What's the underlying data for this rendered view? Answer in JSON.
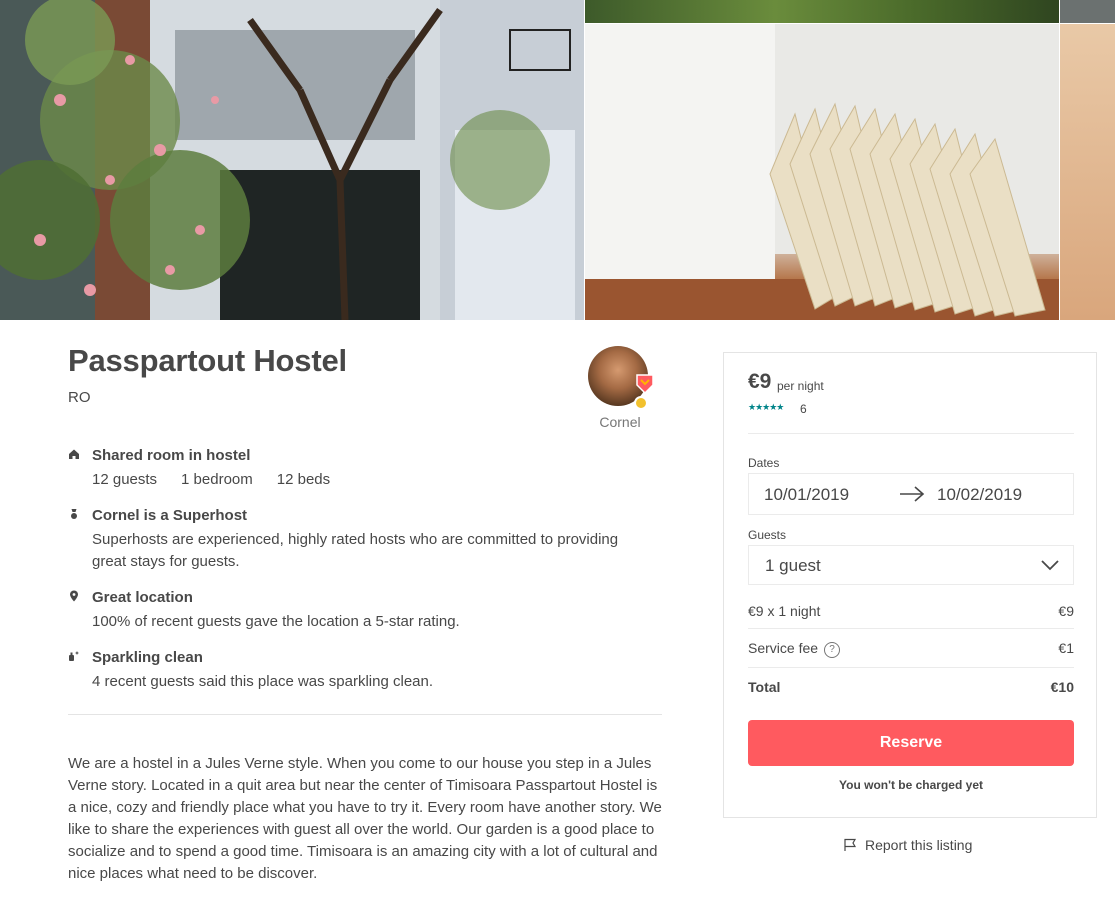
{
  "listing": {
    "title": "Passpartout Hostel",
    "country": "RO",
    "host_name": "Cornel"
  },
  "features": [
    {
      "icon": "home-icon",
      "title": "Shared room in hostel",
      "specs": [
        "12 guests",
        "1 bedroom",
        "12 beds"
      ]
    },
    {
      "icon": "superhost-medal-icon",
      "title": "Cornel is a Superhost",
      "desc": "Superhosts are experienced, highly rated hosts who are committed to providing great stays for guests."
    },
    {
      "icon": "location-pin-icon",
      "title": "Great location",
      "desc": "100% of recent guests gave the location a 5-star rating."
    },
    {
      "icon": "sparkle-clean-icon",
      "title": "Sparkling clean",
      "desc": "4 recent guests said this place was sparkling clean."
    }
  ],
  "description": "We are a hostel in a Jules Verne style. When you come to our house you step in a Jules Verne story. Located in a quit area but near the center of Timisoara Passpartout Hostel is a nice, cozy and friendly place what you have to try it. Every room have another story. We like to share the experiences with guest all over the world. Our garden is a good place to socialize and to spend a good time. Timisoara is an amazing city with a lot of cultural and nice places what need to be discover.",
  "booking": {
    "price": "€9",
    "per_night": "per night",
    "stars": "★★★★★",
    "review_count": "6",
    "dates_label": "Dates",
    "check_in": "10/01/2019",
    "check_out": "10/02/2019",
    "guests_label": "Guests",
    "guests_value": "1 guest",
    "line_nights_label": "€9 x 1 night",
    "line_nights_value": "€9",
    "service_fee_label": "Service fee",
    "service_fee_help": "?",
    "service_fee_value": "€1",
    "total_label": "Total",
    "total_value": "€10",
    "reserve_label": "Reserve",
    "no_charge_note": "You won't be charged yet"
  },
  "report_label": "Report this listing",
  "colors": {
    "brand": "#ff5a5f",
    "stars": "#008489",
    "text": "#484848",
    "muted": "#767676",
    "border": "#e4e4e4"
  }
}
